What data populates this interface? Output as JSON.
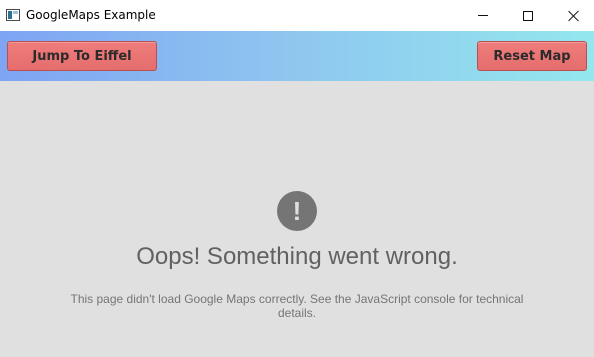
{
  "window": {
    "title": "GoogleMaps Example",
    "icon": "app-window-icon"
  },
  "window_controls": {
    "minimize_icon": "minimize-icon",
    "maximize_icon": "maximize-icon",
    "close_icon": "close-icon"
  },
  "toolbar": {
    "jump_label": "Jump To Eiffel",
    "reset_label": "Reset Map",
    "button_color": "#e87171",
    "gradient_start": "#7ea4f3",
    "gradient_end": "#93e7ee"
  },
  "map": {
    "error_icon": "exclamation-icon",
    "error_icon_glyph": "!",
    "error_title": "Oops! Something went wrong.",
    "error_message": "This page didn't load Google Maps correctly. See the JavaScript console for technical details.",
    "background_color": "#e0e0e0"
  }
}
